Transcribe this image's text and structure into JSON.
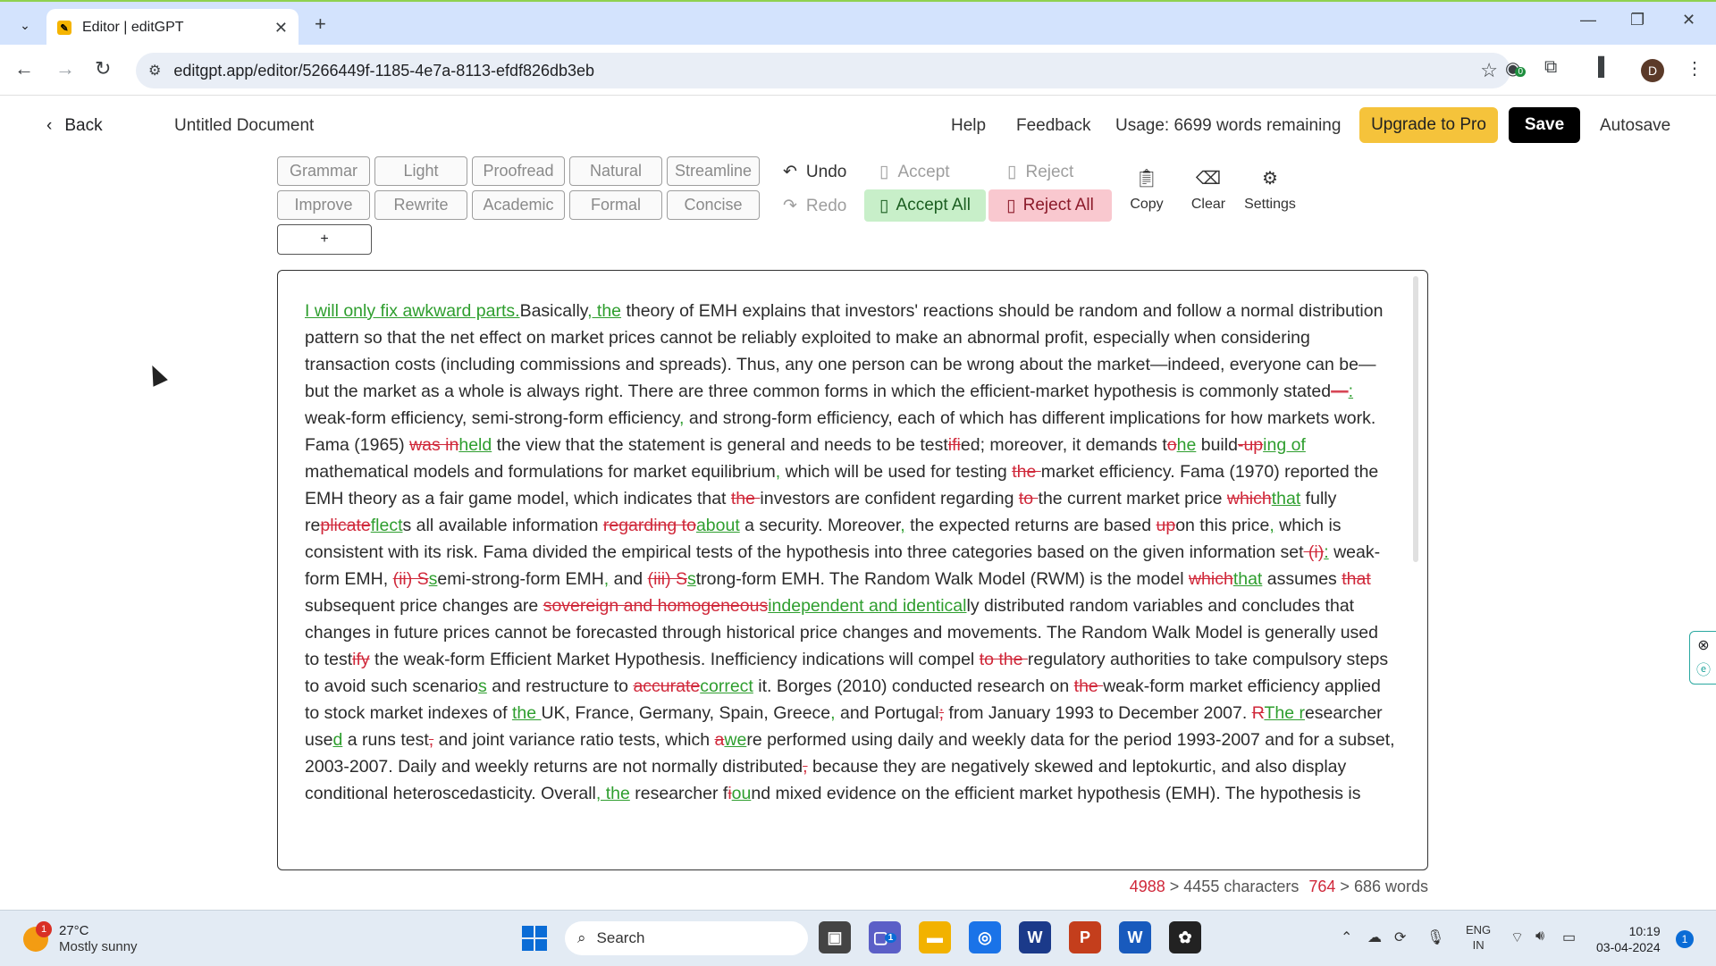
{
  "browser": {
    "tab_title": "Editor | editGPT",
    "url": "editgpt.app/editor/5266449f-1185-4e7a-8113-efdf826db3eb",
    "profile_initial": "D",
    "extension_badge": "0"
  },
  "header": {
    "back_label": "Back",
    "doc_title": "Untitled Document",
    "help": "Help",
    "feedback": "Feedback",
    "usage": "Usage: 6699 words remaining",
    "upgrade": "Upgrade to Pro",
    "save": "Save",
    "autosave": "Autosave"
  },
  "modes": {
    "row1": [
      "Grammar",
      "Light",
      "Proofread",
      "Natural",
      "Streamline"
    ],
    "row2": [
      "Improve",
      "Rewrite",
      "Academic",
      "Formal",
      "Concise"
    ],
    "plus": "+"
  },
  "actions": {
    "undo": "Undo",
    "redo": "Redo",
    "accept": "Accept",
    "reject": "Reject",
    "accept_all": "Accept All",
    "reject_all": "Reject All",
    "copy": "Copy",
    "clear": "Clear",
    "settings": "Settings"
  },
  "editor": {
    "segments": [
      [
        "i",
        "I will only fix awkward parts."
      ],
      [
        "t",
        "Basically"
      ],
      [
        "i",
        ", the"
      ],
      [
        "t",
        " theory of EMH explains that investors' reactions should be random and follow a normal distribution pattern so that the net effect on market prices cannot be reliably exploited to make an abnormal profit, especially when considering transaction costs (including commissions and spreads). Thus, any one person can be wrong about the market—indeed, everyone can be—but the market as a whole is always right. There are three common forms in which the efficient-market hypothesis is commonly stated"
      ],
      [
        "d",
        "—"
      ],
      [
        "i",
        ":"
      ],
      [
        "t",
        " weak-form efficiency, semi-strong-form efficiency"
      ],
      [
        "i",
        ","
      ],
      [
        "t",
        " and strong-form efficiency, each of which has different implications for how markets work. Fama (1965) "
      ],
      [
        "d",
        "was in"
      ],
      [
        "i",
        "held"
      ],
      [
        "t",
        " the view that the statement is general and needs to be test"
      ],
      [
        "d",
        "ifi"
      ],
      [
        "t",
        "ed; moreover, it demands t"
      ],
      [
        "d",
        "o"
      ],
      [
        "i",
        "he"
      ],
      [
        "t",
        " build"
      ],
      [
        "d",
        "-up"
      ],
      [
        "i",
        "ing of"
      ],
      [
        "t",
        " mathematical models and formulations for market equilibrium"
      ],
      [
        "i",
        ","
      ],
      [
        "t",
        " which will be used for testing "
      ],
      [
        "d",
        "the "
      ],
      [
        "t",
        "market efficiency. Fama (1970) reported the EMH theory as a fair game model, which indicates that "
      ],
      [
        "d",
        "the "
      ],
      [
        "t",
        "investors are confident regarding "
      ],
      [
        "d",
        "to "
      ],
      [
        "t",
        "the current market price "
      ],
      [
        "d",
        "which"
      ],
      [
        "i",
        "that"
      ],
      [
        "t",
        " fully re"
      ],
      [
        "d",
        "plicate"
      ],
      [
        "i",
        "flect"
      ],
      [
        "t",
        "s all available information "
      ],
      [
        "d",
        "regarding to"
      ],
      [
        "i",
        "about"
      ],
      [
        "t",
        " a security. Moreover"
      ],
      [
        "i",
        ","
      ],
      [
        "t",
        " the expected returns are based "
      ],
      [
        "d",
        "up"
      ],
      [
        "t",
        "on this price"
      ],
      [
        "i",
        ","
      ],
      [
        "t",
        " which is consistent with its risk. Fama divided the empirical tests of the hypothesis into three categories based on the given information set"
      ],
      [
        "d",
        " (i)"
      ],
      [
        "i",
        ":"
      ],
      [
        "t",
        " weak-form EMH, "
      ],
      [
        "d",
        "(ii) S"
      ],
      [
        "i",
        "s"
      ],
      [
        "t",
        "emi-strong-form EMH"
      ],
      [
        "i",
        ","
      ],
      [
        "t",
        " and "
      ],
      [
        "d",
        "(iii) S"
      ],
      [
        "i",
        "s"
      ],
      [
        "t",
        "trong-form EMH. The Random Walk Model (RWM) is the model "
      ],
      [
        "d",
        "which"
      ],
      [
        "i",
        "that"
      ],
      [
        "t",
        " assumes "
      ],
      [
        "d",
        "that "
      ],
      [
        "t",
        "subsequent price changes are "
      ],
      [
        "d",
        "sovereign and homogeneous"
      ],
      [
        "i",
        "independent and identical"
      ],
      [
        "t",
        "ly distributed random variables and concludes that changes in future prices cannot be forecasted through historical price changes and movements. The Random Walk Model is generally used to test"
      ],
      [
        "d",
        "ify"
      ],
      [
        "t",
        " the weak-form Efficient Market Hypothesis. Inefficiency indications will compel "
      ],
      [
        "d",
        "to the "
      ],
      [
        "t",
        "regulatory authorities to take compulsory steps to avoid such scenario"
      ],
      [
        "i",
        "s"
      ],
      [
        "t",
        " and restructure to "
      ],
      [
        "d",
        "accurate"
      ],
      [
        "i",
        "correct"
      ],
      [
        "t",
        " it. Borges (2010) conducted research on "
      ],
      [
        "d",
        "the "
      ],
      [
        "t",
        "weak-form market efficiency applied to stock market indexes of "
      ],
      [
        "i",
        "the "
      ],
      [
        "t",
        "UK, France, Germany, Spain, Greece"
      ],
      [
        "i",
        ","
      ],
      [
        "t",
        " and Portugal"
      ],
      [
        "d",
        ";"
      ],
      [
        "t",
        " from January 1993 to December 2007. "
      ],
      [
        "d",
        "R"
      ],
      [
        "i",
        "The r"
      ],
      [
        "t",
        "esearcher use"
      ],
      [
        "i",
        "d"
      ],
      [
        "t",
        " a runs test"
      ],
      [
        "d",
        ","
      ],
      [
        "t",
        " and joint variance ratio tests, which "
      ],
      [
        "d",
        "a"
      ],
      [
        "i",
        "we"
      ],
      [
        "t",
        "re performed using daily and weekly data for the period 1993-2007 and for a subset, 2003-2007. Daily and weekly returns are not normally distributed"
      ],
      [
        "d",
        ","
      ],
      [
        "t",
        " because they are negatively skewed and leptokurtic, and also display conditional heteroscedasticity. Overall"
      ],
      [
        "i",
        ", the"
      ],
      [
        "t",
        " researcher f"
      ],
      [
        "d",
        "i"
      ],
      [
        "i",
        "ou"
      ],
      [
        "t",
        "nd mixed evidence on the efficient market hypothesis (EMH). The hypothesis is"
      ]
    ],
    "counts": {
      "chars_from": "4988",
      "chars_sep": " > ",
      "chars_to": "4455 characters",
      "words_from": "764",
      "words_sep": " > ",
      "words_to": "686 words"
    }
  },
  "taskbar": {
    "weather_temp": "27°C",
    "weather_desc": "Mostly sunny",
    "weather_badge": "1",
    "search": "Search",
    "lang1": "ENG",
    "lang2": "IN",
    "time": "10:19",
    "date": "03-04-2024",
    "notifications": "1",
    "teams_badge": "1"
  },
  "colors": {
    "insert": "#2e9e2e",
    "delete": "#d0283a",
    "upgrade": "#f5c33b",
    "accept_all_bg": "#c8efc9",
    "reject_all_bg": "#f9c8cf"
  }
}
